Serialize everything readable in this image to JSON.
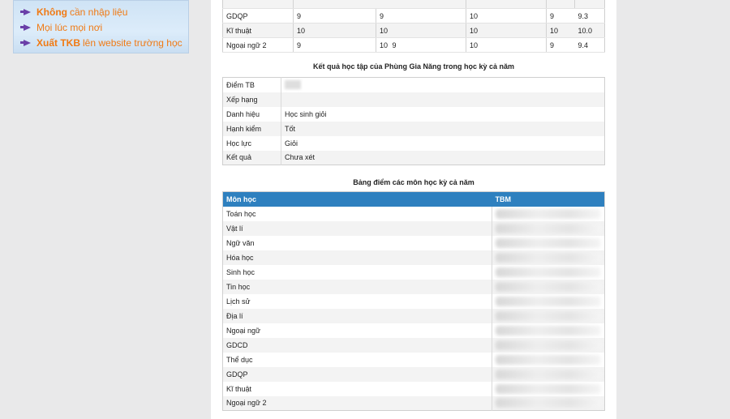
{
  "ad": {
    "lines": [
      {
        "highlight": "Không",
        "text": "cần nhập liệu"
      },
      {
        "highlight": "",
        "text": "Mọi lúc mọi nơi"
      },
      {
        "highlight": "Xuất TKB",
        "text": "lên website trường học"
      }
    ]
  },
  "top_table": {
    "rows": [
      {
        "subject": "GDQP",
        "c1": "9",
        "c2": "9",
        "c3": "",
        "c4": "10",
        "c5": "9",
        "c6": "9.3"
      },
      {
        "subject": "Kĩ thuật",
        "c1": "10",
        "c2": "10",
        "c3": "",
        "c4": "10",
        "c5": "10",
        "c6": "10.0"
      },
      {
        "subject": "Ngoại ngữ 2",
        "c1": "9",
        "c2": "10",
        "c3": "9",
        "c4": "10",
        "c5": "9",
        "c6": "9.4"
      }
    ]
  },
  "results": {
    "title": "Kết quả học tập của Phùng Gia Năng trong học kỳ cả năm",
    "rows": [
      {
        "label": "Điểm TB",
        "value": ""
      },
      {
        "label": "Xếp hạng",
        "value": ""
      },
      {
        "label": "Danh hiệu",
        "value": "Học sinh giỏi"
      },
      {
        "label": "Hạnh kiểm",
        "value": "Tốt"
      },
      {
        "label": "Học lực",
        "value": "Giỏi"
      },
      {
        "label": "Kết quả",
        "value": "Chưa xét"
      }
    ]
  },
  "scores": {
    "title": "Bảng điểm các môn học kỳ cả năm",
    "col_subject": "Môn học",
    "col_tbm": "TBM",
    "subjects": [
      "Toán học",
      "Vật lí",
      "Ngữ văn",
      "Hóa học",
      "Sinh học",
      "Tin học",
      "Lịch sử",
      "Địa lí",
      "Ngoại ngữ",
      "GDCD",
      "Thể dục",
      "GDQP",
      "Kĩ thuật",
      "Ngoại ngữ 2"
    ]
  },
  "colors": {
    "header_blue": "#2e80bf",
    "ad_orange": "#f07a14",
    "ad_purple": "#6a3fa8"
  }
}
